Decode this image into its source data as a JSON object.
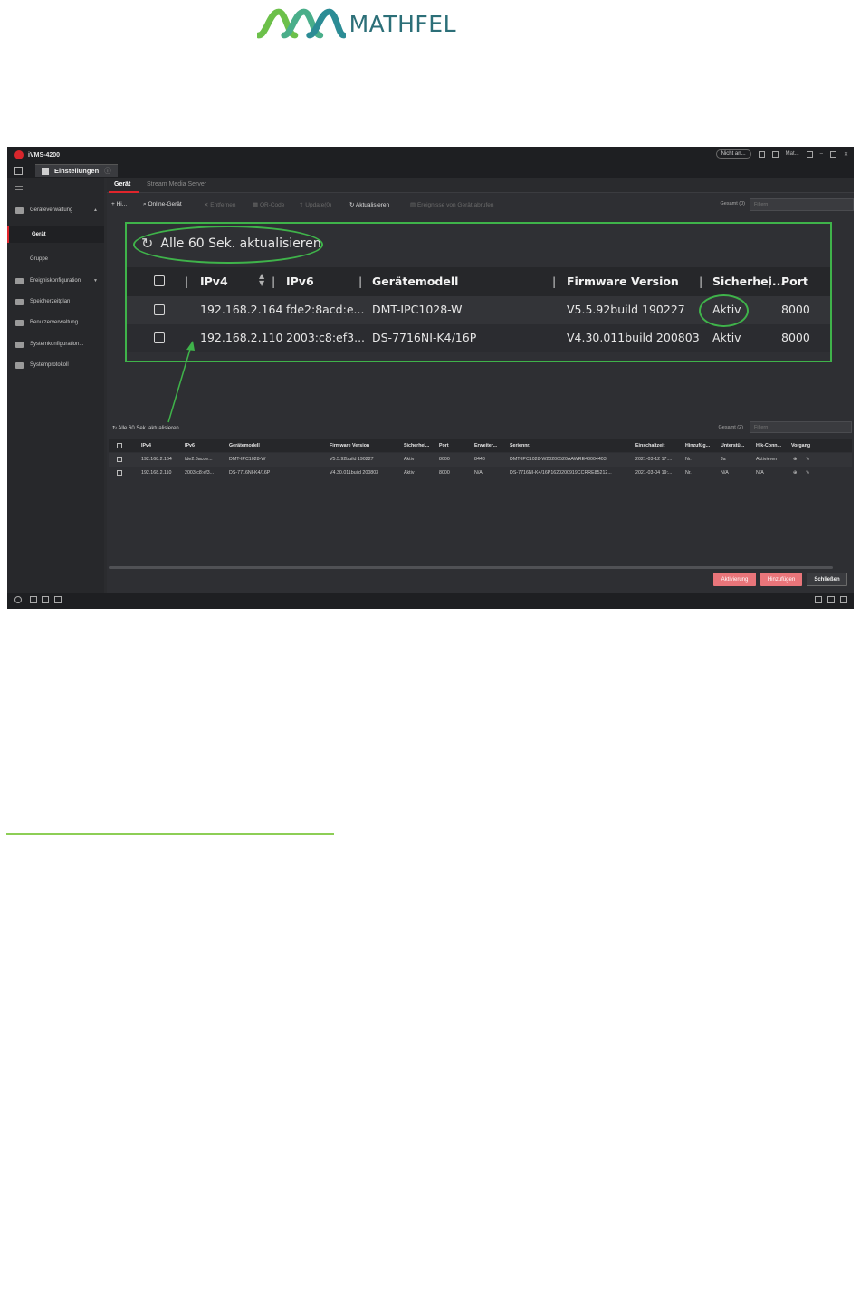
{
  "brand": {
    "logo_text": "MATHFEL",
    "colors": {
      "logo_green": "#6cc04a",
      "logo_teal": "#2c8c95",
      "accent_red": "#e0252c",
      "callout_green": "#3fb34a",
      "rule_green": "#8dce56"
    }
  },
  "app": {
    "name": "iVMS-4200",
    "titlebar": {
      "status_pill": "Nicht an...",
      "user": "Mat..."
    },
    "main_tab": "Einstellungen",
    "sidebar": [
      {
        "label": "Geräteverwaltung",
        "icon": "device-icon"
      },
      {
        "label": "Gerät",
        "active": true
      },
      {
        "label": "Gruppe"
      },
      {
        "label": "Ereigniskonfiguration",
        "icon": "event-icon"
      },
      {
        "label": "Speicherzeitplan",
        "icon": "storage-icon"
      },
      {
        "label": "Benutzerverwaltung",
        "icon": "user-icon"
      },
      {
        "label": "Systemkonfiguration...",
        "icon": "system-icon"
      },
      {
        "label": "Systemprotokoll",
        "icon": "log-icon"
      }
    ],
    "subtabs": {
      "device": "Gerät",
      "stream": "Stream Media Server"
    },
    "toolbar": {
      "add": "+ Hi...",
      "online": "Online-Gerät",
      "remove": "Entfernen",
      "qr": "QR-Code",
      "upgrade": "Update(0)",
      "refresh": "Aktualisieren",
      "events": "Ereignisse von Gerät abrufen",
      "total": "Gesamt (0)",
      "filter_placeholder": "Filtern"
    },
    "zoom": {
      "refresh_label": "Alle 60 Sek. aktualisieren",
      "columns": [
        "IPv4",
        "IPv6",
        "Gerätemodell",
        "Firmware Version",
        "Sicherhei...",
        "Port"
      ],
      "rows": [
        {
          "ipv4": "192.168.2.164",
          "ipv6": "fde2:8acd:e...",
          "model": "DMT-IPC1028-W",
          "firmware": "V5.5.92build 190227",
          "security": "Aktiv",
          "port": "8000"
        },
        {
          "ipv4": "192.168.2.110",
          "ipv6": "2003:c8:ef3...",
          "model": "DS-7716NI-K4/16P",
          "firmware": "V4.30.011build 200803",
          "security": "Aktiv",
          "port": "8000"
        }
      ]
    },
    "lower": {
      "refresh_label": "Alle 60 Sek. aktualisieren",
      "total": "Gesamt (2)",
      "filter_placeholder": "Filtern",
      "columns": [
        "IPv4",
        "IPv6",
        "Gerätemodell",
        "Firmware Version",
        "Sicherhei...",
        "Port",
        "Erweiter...",
        "Seriennr.",
        "Einschaltzeit",
        "Hinzufüg...",
        "Unterstü...",
        "Hik-Conn...",
        "Vorgang"
      ],
      "rows": [
        {
          "ipv4": "192.168.2.164",
          "ipv6": "fde2:8acde...",
          "model": "DMT-IPC1028-W",
          "firmware": "V5.5.92build 190227",
          "security": "Aktiv",
          "port": "8000",
          "ext": "8443",
          "serial": "DMT-IPC1028-W20200520AAWRE43004403",
          "boot": "2021-03-12 17:...",
          "added": "Nr.",
          "support": "Ja",
          "hik": "Aktivieren"
        },
        {
          "ipv4": "192.168.2.110",
          "ipv6": "2003:c8:ef3...",
          "model": "DS-7716NI-K4/16P",
          "firmware": "V4.30.011build 200803",
          "security": "Aktiv",
          "port": "8000",
          "ext": "N/A",
          "serial": "DS-7716NI-K4/16P1620200919CCRRE85212...",
          "boot": "2021-03-04 19:...",
          "added": "Nr.",
          "support": "N/A",
          "hik": "N/A"
        }
      ]
    },
    "buttons": {
      "activate": "Aktivierung",
      "add": "Hinzufügen",
      "close": "Schließen"
    }
  }
}
